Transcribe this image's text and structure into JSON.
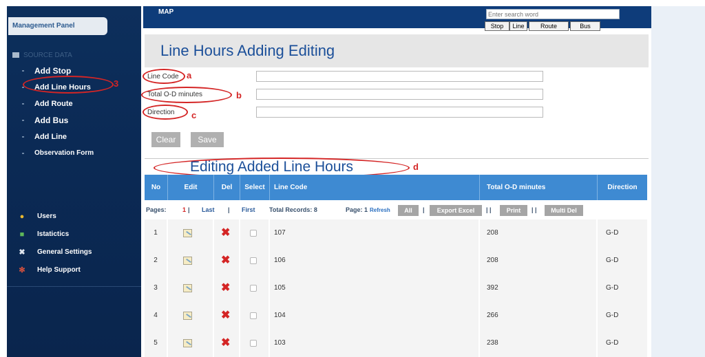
{
  "sidebar": {
    "panel_title": "Management Panel",
    "source_heading": "SOURCE DATA",
    "source_items": [
      {
        "label": "Add Stop"
      },
      {
        "label": "Add Line Hours"
      },
      {
        "label": "Add Route"
      },
      {
        "label": "Add Bus"
      },
      {
        "label": "Add Line"
      },
      {
        "label": "Observation Form"
      }
    ],
    "other_items": [
      {
        "label": "Users",
        "icon": "users-icon"
      },
      {
        "label": "Istatictics",
        "icon": "chart-icon"
      },
      {
        "label": "General Settings",
        "icon": "tools-icon"
      },
      {
        "label": "Help Support",
        "icon": "lifebuoy-icon"
      }
    ]
  },
  "topbar": {
    "map_label": "MAP",
    "search_placeholder": "Enter search word",
    "segments": [
      "Stop",
      "Line",
      "Route",
      "Bus"
    ]
  },
  "page": {
    "title": "Line Hours Adding Editing",
    "form": {
      "line_code_label": "Line Code",
      "total_minutes_label": "Total O-D minutes",
      "direction_label": "Direction",
      "line_code_value": "",
      "total_minutes_value": "",
      "direction_value": ""
    },
    "clear_label": "Clear",
    "save_label": "Save",
    "section_title": "Editing Added Line Hours"
  },
  "annotations": {
    "a": "a",
    "b": "b",
    "c": "c",
    "d": "d",
    "three": "3"
  },
  "table": {
    "headers": {
      "no": "No",
      "edit": "Edit",
      "del": "Del",
      "select": "Select",
      "line_code": "Line Code",
      "total": "Total O-D minutes",
      "direction": "Direction"
    },
    "pager": {
      "pages_label": "Pages:",
      "current_page": "1",
      "sep1": "|",
      "last": "Last",
      "sep2": "|",
      "first": "First",
      "total_records": "Total Records: 8",
      "page_label": "Page: 1",
      "refresh": "Refresh",
      "all": "All",
      "sep3": "|",
      "export_excel": "Export Excel",
      "sep4": "| |",
      "print": "Print",
      "sep5": "| |",
      "multi_del": "Multi Del"
    },
    "rows": [
      {
        "no": "1",
        "line_code": "107",
        "total": "208",
        "direction": "G-D"
      },
      {
        "no": "2",
        "line_code": "106",
        "total": "208",
        "direction": "G-D"
      },
      {
        "no": "3",
        "line_code": "105",
        "total": "392",
        "direction": "G-D"
      },
      {
        "no": "4",
        "line_code": "104",
        "total": "266",
        "direction": "G-D"
      },
      {
        "no": "5",
        "line_code": "103",
        "total": "238",
        "direction": "G-D"
      }
    ]
  },
  "colors": {
    "sidebar_bg": "#0b2a55",
    "topbar_bg": "#0e3c7a",
    "table_header": "#3e8ad2",
    "title_text": "#1b4f99",
    "annotation_red": "#d42525"
  }
}
